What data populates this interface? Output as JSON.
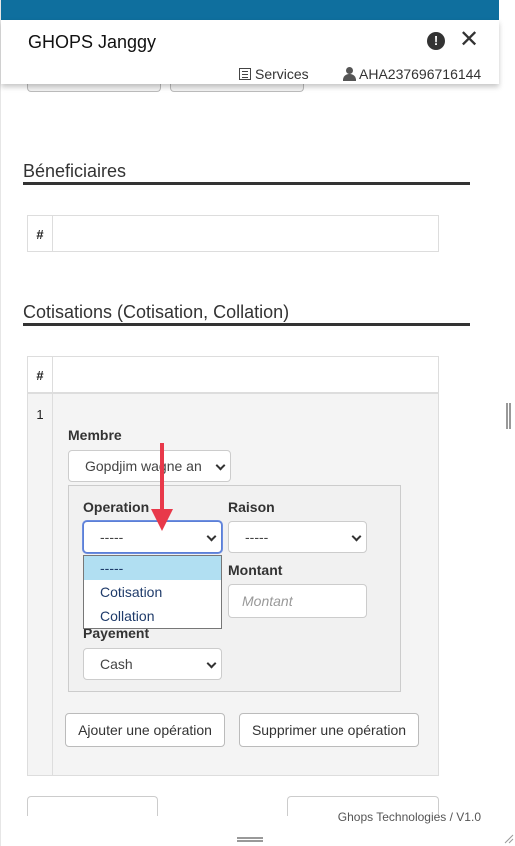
{
  "header": {
    "app_title": "GHOPS Janggy",
    "services_label": "Services",
    "user_label": "AHA237696716144"
  },
  "icons": {
    "info": "alert-circle-icon",
    "close": "close-icon",
    "services": "list-icon",
    "user": "user-icon"
  },
  "beneficiaires": {
    "title": "Béneficiaires",
    "columns": [
      "#",
      ""
    ]
  },
  "cotisations": {
    "title": "Cotisations (Cotisation, Collation)",
    "columns": [
      "#",
      ""
    ],
    "rows": [
      {
        "index": "1",
        "membre_label": "Membre",
        "membre_value": "Gopdjim wagne an",
        "operation_label": "Operation",
        "operation_value": "-----",
        "operation_options": [
          "-----",
          "Cotisation",
          "Collation"
        ],
        "raison_label": "Raison",
        "raison_value": "-----",
        "montant_label": "Montant",
        "montant_placeholder": "Montant",
        "payement_label": "Payement",
        "payement_value": "Cash",
        "add_label": "Ajouter une opération",
        "remove_label": "Supprimer une opération"
      }
    ]
  },
  "footer": {
    "text": "Ghops Technologies / V1.0"
  },
  "colors": {
    "topbar": "#0f6f9e",
    "dropdown_selected": "#b1dff2",
    "annotation_arrow": "#e8394a"
  }
}
